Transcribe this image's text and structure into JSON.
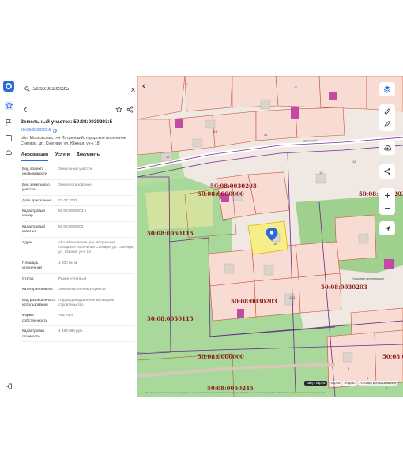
{
  "search": {
    "query": "50:08:0030203:5"
  },
  "object": {
    "title": "Земельный участок: 50:08:0030203:5",
    "cad_number": "50:08:0030203:5",
    "address": "обл. Московская, р-н Истринский, городское поселение Снегири, дп. Снегири, ул. Южная, уч-к 18"
  },
  "tabs": [
    {
      "label": "Информация"
    },
    {
      "label": "Услуги"
    },
    {
      "label": "Документы"
    }
  ],
  "properties": [
    {
      "key": "Вид объекта недвижимости",
      "value": "Земельный участок"
    },
    {
      "key": "Вид земельного участка",
      "value": "Землепользование"
    },
    {
      "key": "Дата присвоения",
      "value": "03.07.2002"
    },
    {
      "key": "Кадастровый номер",
      "value": "50:08:0030203:5"
    },
    {
      "key": "Кадастровый квартал",
      "value": "50:08:0030203"
    },
    {
      "key": "Адрес",
      "value": "обл. Московская, р-н Истринский, городское поселение Снегири, дп. Снегири, ул. Южная, уч-к 18"
    },
    {
      "key": "Площадь уточненная",
      "value": "1 200 кв. м"
    },
    {
      "key": "Статус",
      "value": "Ранее учтенный"
    },
    {
      "key": "Категория земель",
      "value": "Земли населенных пунктов"
    },
    {
      "key": "Вид разрешенного использования",
      "value": "Под индивидуальное жилищное строительство"
    },
    {
      "key": "Форма собственности",
      "value": "Частная"
    },
    {
      "key": "Кадастровая стоимость",
      "value": "4 493 088 руб."
    }
  ],
  "map": {
    "quarter_labels": [
      "50:08:0030203",
      "50:08:0000000",
      "50:08:0050115",
      "50:08:0030203",
      "50:08:0050115",
      "50:08:0000000",
      "50:08:0050245",
      "50:08:0030203",
      "50:08:0030203",
      "50:08:00"
    ],
    "street_label": "Южная ул.",
    "place_label": "Ушаковое прилегающее",
    "parcel_numbers": [
      "11",
      "64",
      "19",
      "54",
      "11",
      "18",
      "22",
      "18",
      "13/1",
      "16",
      "3",
      "8",
      "1"
    ],
    "footer": {
      "satellite": "Вид с карты",
      "maps": "Карты",
      "yandex": "Яндекс",
      "terms": "Условия использования",
      "disclaimer": "Перед использованием: данные официальными не являются и носят справочный характер. Подробнее о составе сведений в соответствии с требованиями законодательства."
    }
  },
  "colors": {
    "accent": "#2d6ad9",
    "selected_parcel": "#f6ee8a",
    "cad_label": "#8a1a1a",
    "forest": "#a8d89a",
    "parcel_fill": "#f8dcd4",
    "building": "#c24aa5"
  },
  "icons": {
    "logo": "app-logo-icon",
    "search": "search-icon",
    "close": "close-icon",
    "back": "back-arrow-icon",
    "favorite": "star-icon",
    "share": "share-icon",
    "copy": "copy-icon",
    "layers": "layers-icon",
    "ruler": "ruler-icon",
    "edit": "edit-icon",
    "upload": "cloud-upload-icon",
    "nodes": "share-nodes-icon",
    "zoom_in": "plus-icon",
    "zoom_out": "minus-icon",
    "locate": "location-arrow-icon",
    "logout": "logout-icon"
  }
}
